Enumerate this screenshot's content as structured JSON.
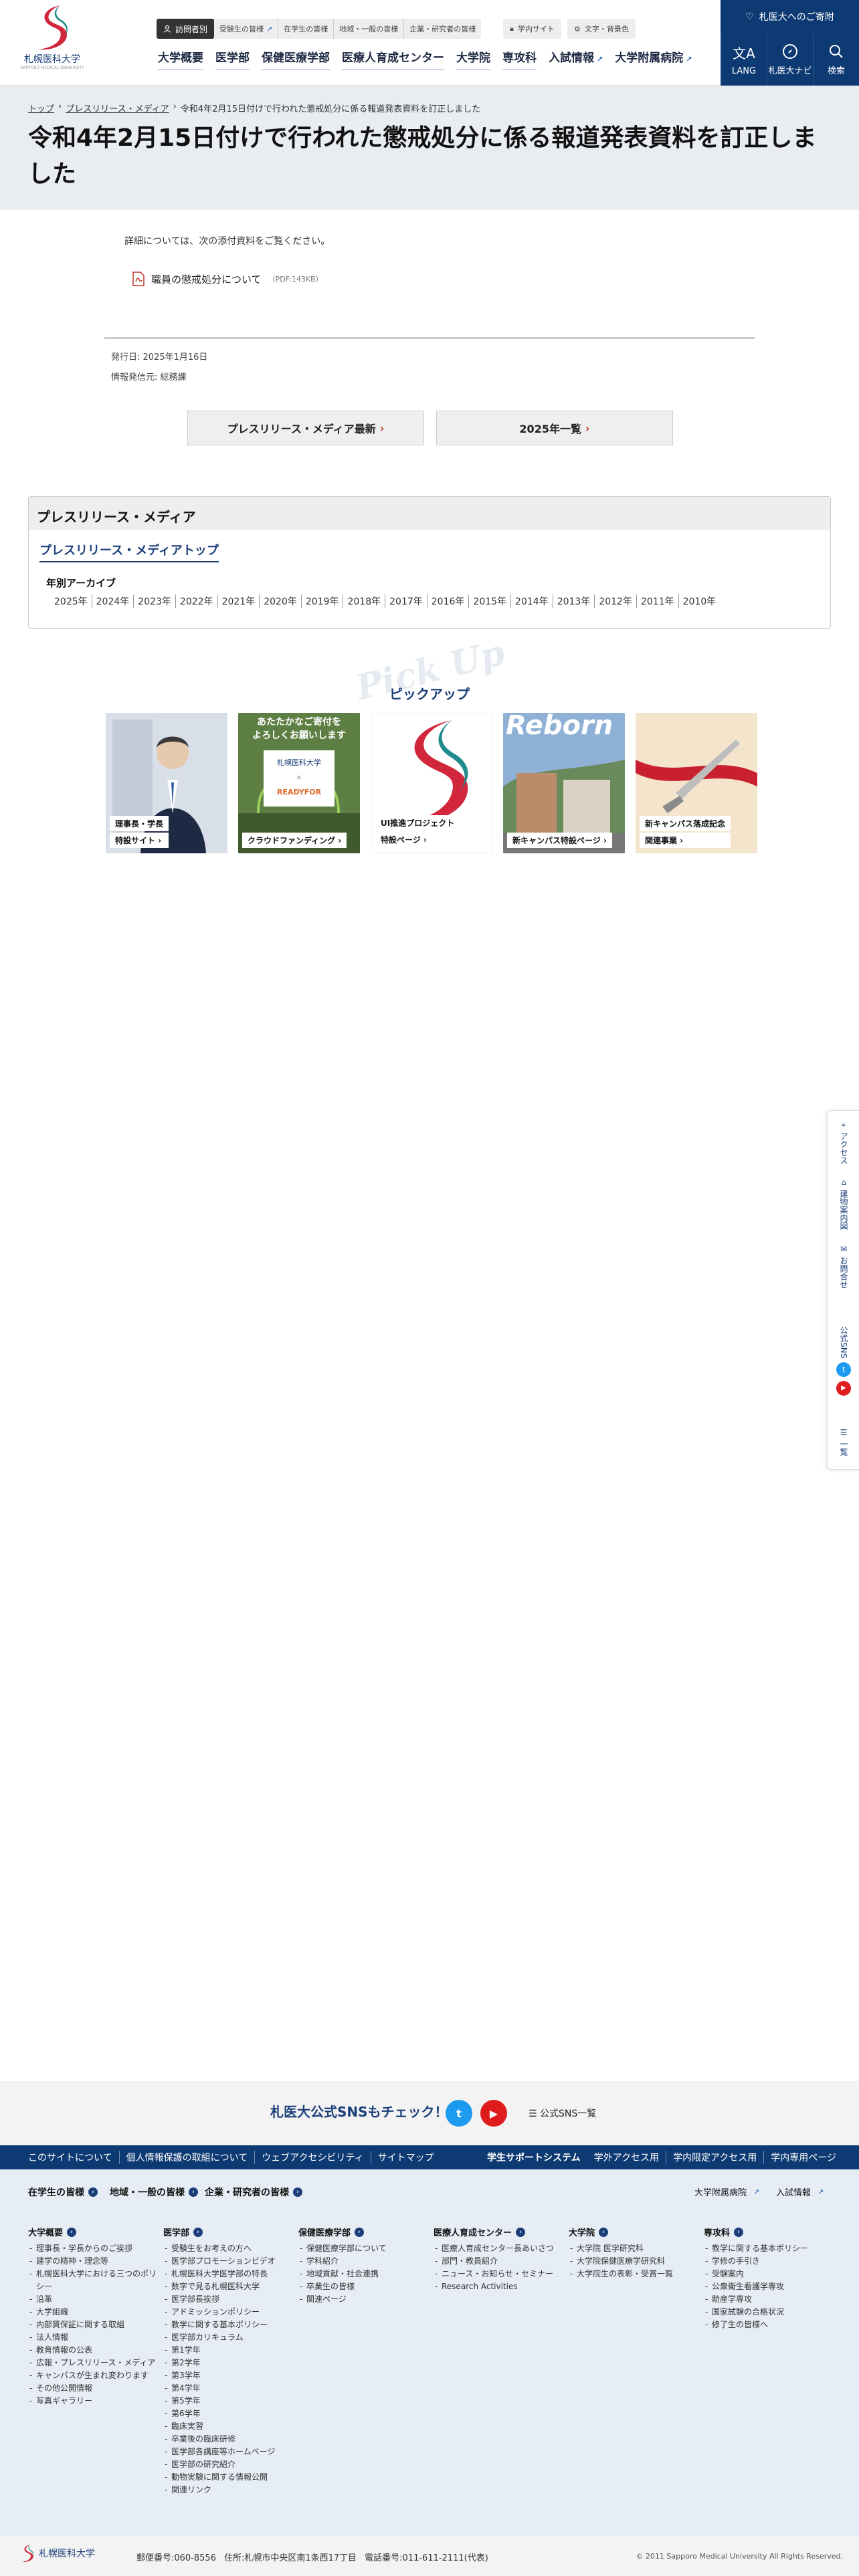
{
  "header": {
    "logo_name": "札幌医科大学",
    "logo_sub": "SAPPORO MEDICAL UNIVERSITY",
    "targets": [
      "訪問者別",
      "受験生の皆様",
      "在学生の皆様",
      "地域・一般の皆様",
      "企業・研究者の皆様"
    ],
    "util_campus": "学内サイト",
    "util_font": "文字・背景色",
    "nav": [
      "大学概要",
      "医学部",
      "保健医療学部",
      "医療人育成センター",
      "大学院",
      "専攻科",
      "入試情報",
      "大学附属病院"
    ],
    "donate": "札医大へのご寄附",
    "lang": "LANG",
    "navi": "札医大ナビ",
    "search": "検索"
  },
  "breadcrumb": {
    "top": "トップ",
    "press": "プレスリリース・メディア",
    "current": "令和4年2月15日付けで行われた懲戒処分に係る報道発表資料を訂正しました"
  },
  "page_title": "令和4年2月15日付けで行われた懲戒処分に係る報道発表資料を訂正しました",
  "content": {
    "lead": "詳細については、次の添付資料をご覧ください。",
    "file_label": "職員の懲戒処分について",
    "file_meta": "（PDF:143KB）",
    "published": "発行日: 2025年1月16日",
    "source": "情報発信元: 総務課",
    "btn_latest": "プレスリリース・メディア最新",
    "btn_year": "2025年一覧"
  },
  "sidebox": {
    "title": "プレスリリース・メディア",
    "top_link": "プレスリリース・メディアトップ",
    "archive_title": "年別アーカイブ",
    "years": [
      "2025年",
      "2024年",
      "2023年",
      "2022年",
      "2021年",
      "2020年",
      "2019年",
      "2018年",
      "2017年",
      "2016年",
      "2015年",
      "2014年",
      "2013年",
      "2012年",
      "2011年",
      "2010年"
    ]
  },
  "pickup": {
    "bg_word": "Pick Up",
    "title": "ピックアップ",
    "banners": [
      {
        "line1": "理事長・学長",
        "line2": "特設サイト"
      },
      {
        "head1": "あたたかなご寄付を",
        "head2": "よろしくお願いします",
        "brand": "札幌医科大学",
        "brand2": "READYFOR",
        "line1": "クラウドファンディング"
      },
      {
        "line1": "UI推進プロジェクト",
        "line2": "特設ページ"
      },
      {
        "head1": "Reborn",
        "line1": "新キャンパス特設ページ"
      },
      {
        "line1": "新キャンパス落成記念",
        "line2": "関連事業"
      }
    ]
  },
  "sidetab": {
    "access": "アクセス",
    "map": "建物案内図",
    "contact": "お問合せ",
    "sns": "公式SNS",
    "list": "一覧"
  },
  "footer": {
    "sns_text": "札医大公式SNSもチェック！",
    "sns_list": "公式SNS一覧",
    "links": [
      "このサイトについて",
      "個人情報保護の取組について",
      "ウェブアクセシビリティ",
      "サイトマップ"
    ],
    "links_right": [
      "学生サポートシステム",
      "学外アクセス用",
      "学内限定アクセス用",
      "学内専用ページ"
    ],
    "targets": [
      "在学生の皆様",
      "地域・一般の皆様",
      "企業・研究者の皆様"
    ],
    "right_links": [
      "大学附属病院",
      "入試情報"
    ],
    "cols": [
      {
        "h": "大学概要",
        "items": [
          "理事長・学長からのご挨拶",
          "建学の精神・理念等",
          "札幌医科大学における三つのポリシー",
          "沿革",
          "大学組織",
          "内部質保証に関する取組",
          "法人情報",
          "教育情報の公表",
          "広報・プレスリリース・メディア",
          "キャンパスが生まれ変わります",
          "その他公開情報",
          "写真ギャラリー"
        ]
      },
      {
        "h": "医学部",
        "items": [
          "受験生をお考えの方へ",
          "医学部プロモーションビデオ",
          "札幌医科大学医学部の特長",
          "数字で見る札幌医科大学",
          "医学部長挨拶",
          "アドミッションポリシー",
          "教学に関する基本ポリシー",
          "医学部カリキュラム",
          "第1学年",
          "第2学年",
          "第3学年",
          "第4学年",
          "第5学年",
          "第6学年",
          "臨床実習",
          "卒業後の臨床研修",
          "医学部各講座等ホームページ",
          "医学部の研究紹介",
          "動物実験に関する情報公開",
          "関連リンク"
        ]
      },
      {
        "h": "保健医療学部",
        "items": [
          "保健医療学部について",
          "学科紹介",
          "地域貢献・社会連携",
          "卒業生の皆様",
          "関連ページ"
        ]
      },
      {
        "h": "医療人育成センター",
        "items": [
          "医療人育成センター長あいさつ",
          "部門・教員紹介",
          "ニュース・お知らせ・セミナー",
          "Research Activities"
        ]
      },
      {
        "h": "大学院",
        "items": [
          "大学院 医学研究科",
          "大学院保健医療学研究科",
          "大学院生の表彰・受賞一覧"
        ]
      },
      {
        "h": "専攻科",
        "items": [
          "教学に関する基本ポリシー",
          "学修の手引き",
          "受験案内",
          "公衆衛生看護学専攻",
          "助産学専攻",
          "国家試験の合格状況",
          "修了生の皆様へ"
        ]
      }
    ],
    "address_post": "郵便番号:060-8556",
    "address": "住所:札幌市中央区南1条西17丁目",
    "tel": "電話番号:011-611-2111(代表)",
    "copyright": "© 2011 Sapporo Medical University All Rights Reserved."
  }
}
